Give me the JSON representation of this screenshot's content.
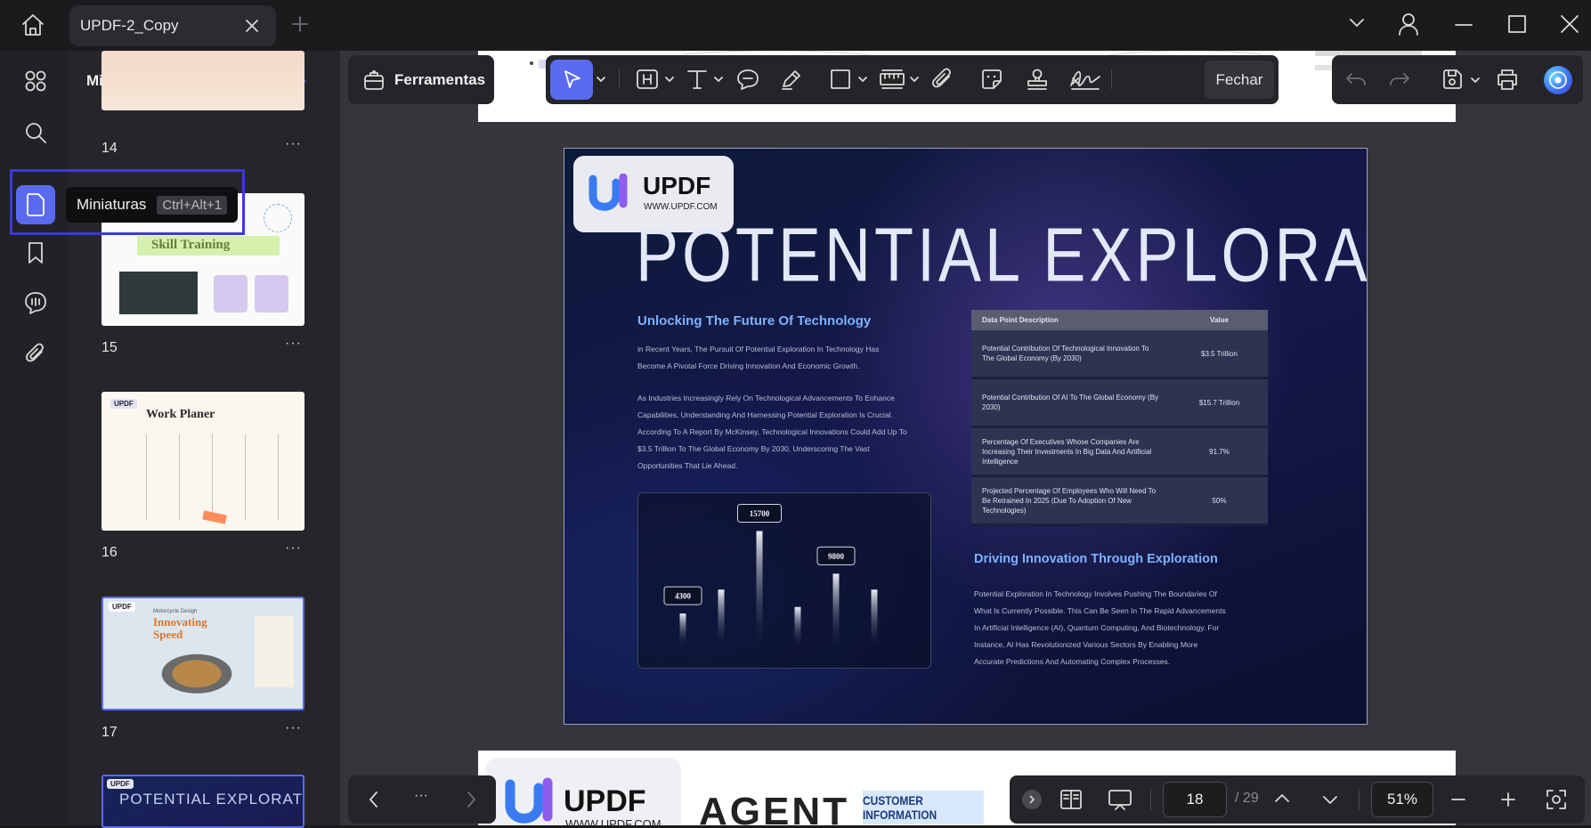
{
  "window": {
    "tab_title": "UPDF-2_Copy"
  },
  "sidebar": {
    "panel_title": "Miniaturas",
    "tooltip_label": "Miniaturas",
    "tooltip_shortcut": "Ctrl+Alt+1",
    "rail_items": [
      "apps-icon",
      "search-icon",
      "thumbnails-icon",
      "bookmark-icon",
      "comments-icon",
      "attachment-icon"
    ],
    "thumbnails": [
      {
        "page": "14",
        "title": ""
      },
      {
        "page": "15",
        "title": "Skill Training"
      },
      {
        "page": "16",
        "title": "Work Planer"
      },
      {
        "page": "17",
        "title": "Innovating Speed",
        "subtitle": "Motorcycle Design"
      },
      {
        "page": "18",
        "title": "POTENTIAL EXPLORATION"
      }
    ],
    "thumb_brand": "UPDF"
  },
  "toolbar": {
    "tools_label": "Ferramentas",
    "close_label": "Fechar"
  },
  "slide": {
    "brand": "UPDF",
    "url": "WWW.UPDF.COM",
    "title": "POTENTIAL EXPLORATION",
    "heading1": "Unlocking The Future Of Technology",
    "para1": "in Recent Years, The Pursuit Of Potential Exploration In Technology Has Become A Pivotal Force Driving Innovation And Economic Growth.",
    "para2": "As Industries Increasingly Rely On Technological Advancements To Enhance Capabilities, Understanding And Harnessing Potential Exploration Is Crucial. According To A Report By McKinsey, Technological Innovations Could Add Up To $3.5 Trillion To The Global Economy By 2030, Underscoring The Vast Opportunities That Lie Ahead.",
    "table": {
      "headers": [
        "Data Point Description",
        "Value"
      ],
      "rows": [
        [
          "Potential Contribution Of Technological Innovation To The Global Economy (By 2030)",
          "$3.5 Trillion"
        ],
        [
          "Potential Contribution Of AI To The Global Economy (By 2030)",
          "$15.7 Trillion"
        ],
        [
          "Percentage Of Executives Whose Companies Are Increasing Their Investments In Big Data And Artificial Intelligence",
          "91.7%"
        ],
        [
          "Projected Percentage Of Employees Who Will Need To Be Retrained In 2025 (Due To Adoption Of New Technologies)",
          "50%"
        ]
      ]
    },
    "heading2": "Driving Innovation Through Exploration",
    "para3": "Potential Exploration In Technology Involves Pushing The Boundaries Of What Is Currently Possible. This Can Be Seen In The Rapid Advancements In Artificial Intelligence (AI), Quantum Computing, And Biotechnology. For Instance, AI Has Revolutionized Various Sectors By Enabling More Accurate Predictions And Automating Complex Processes.",
    "chart_labels": [
      "4300",
      "15700",
      "9800"
    ]
  },
  "chart_data": {
    "type": "bar",
    "values": [
      4300,
      7600,
      15700,
      5200,
      9800,
      7600
    ],
    "data_labels": [
      {
        "index": 0,
        "text": "4300"
      },
      {
        "index": 2,
        "text": "15700"
      },
      {
        "index": 4,
        "text": "9800"
      }
    ],
    "ylim": [
      0,
      16000
    ],
    "grid": false
  },
  "next_page": {
    "brand": "UPDF",
    "url": "WWW.UPDF.COM",
    "agent_text": "AGENT",
    "customer_label": "CUSTOMER INFORMATION"
  },
  "nav": {
    "current_page": "18",
    "total_pages": "/ 29",
    "zoom": "51%"
  }
}
